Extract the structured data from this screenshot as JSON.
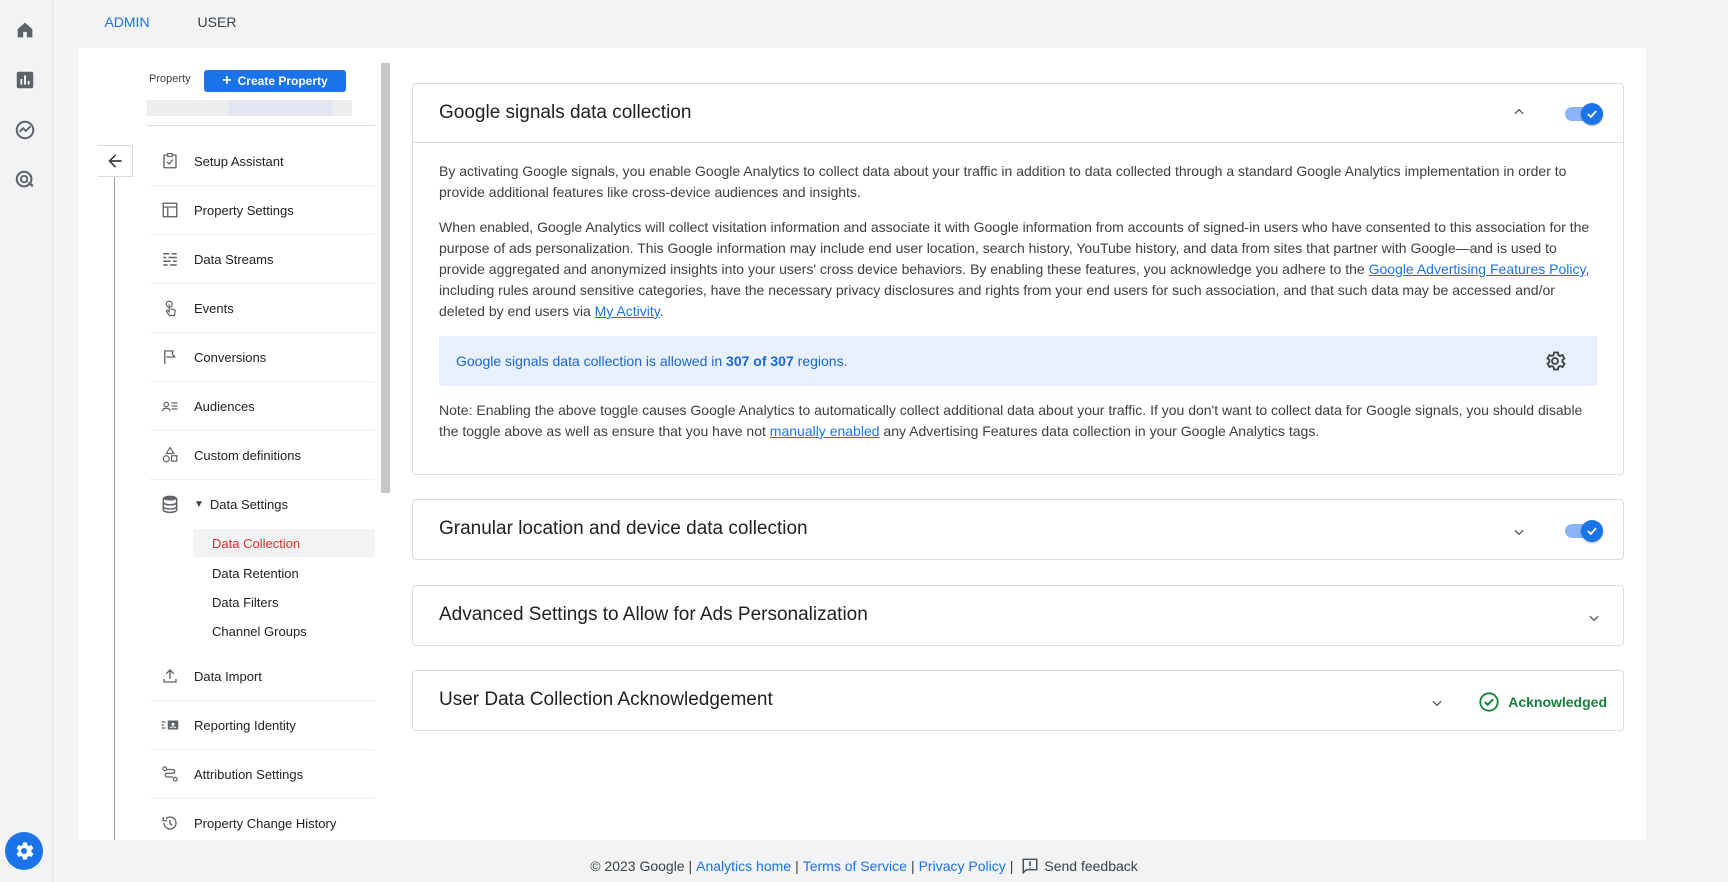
{
  "tabs": {
    "admin": "ADMIN",
    "user": "USER"
  },
  "rail": {
    "icons": [
      "home-icon",
      "reports-icon",
      "explore-icon",
      "advertising-icon"
    ],
    "settings_icon": "gear-icon"
  },
  "property": {
    "label": "Property",
    "create_button": "Create Property"
  },
  "nav": {
    "items": [
      {
        "label": "Setup Assistant",
        "icon": "checklist-icon"
      },
      {
        "label": "Property Settings",
        "icon": "window-icon"
      },
      {
        "label": "Data Streams",
        "icon": "streams-icon"
      },
      {
        "label": "Events",
        "icon": "touch-icon"
      },
      {
        "label": "Conversions",
        "icon": "flag-icon"
      },
      {
        "label": "Audiences",
        "icon": "audiences-icon"
      },
      {
        "label": "Custom definitions",
        "icon": "shapes-icon"
      },
      {
        "label": "Data Settings",
        "icon": "database-icon"
      }
    ],
    "sub_items": [
      "Data Collection",
      "Data Retention",
      "Data Filters",
      "Channel Groups"
    ],
    "items_after": [
      {
        "label": "Data Import",
        "icon": "upload-icon"
      },
      {
        "label": "Reporting Identity",
        "icon": "identity-icon"
      },
      {
        "label": "Attribution Settings",
        "icon": "attribution-icon"
      },
      {
        "label": "Property Change History",
        "icon": "history-icon"
      }
    ]
  },
  "cards": {
    "signals": {
      "title": "Google signals data collection",
      "p1": "By activating Google signals, you enable Google Analytics to collect data about your traffic in addition to data collected through a standard Google Analytics implementation in order to provide additional features like cross-device audiences and insights.",
      "p2_a": "When enabled, Google Analytics will collect visitation information and associate it with Google information from accounts of signed-in users who have consented to this association for the purpose of ads personalization. This Google information may include end user location, search history, YouTube history, and data from sites that partner with Google—and is used to provide aggregated and anonymized insights into your users' cross device behaviors. By enabling these features, you acknowledge you adhere to the ",
      "p2_link1": "Google Advertising Features Policy",
      "p2_b": ", including rules around sensitive categories, have the necessary privacy disclosures and rights from your end users for such association, and that such data may be accessed and/or deleted by end users via ",
      "p2_link2": "My Activity",
      "p2_c": ".",
      "info_a": "Google signals data collection is allowed in ",
      "info_bold": "307 of 307",
      "info_b": " regions.",
      "note_a": "Note: Enabling the above toggle causes Google Analytics to automatically collect additional data about your traffic. If you don't want to collect data for Google signals, you should disable the toggle above as well as ensure that you have not ",
      "note_link": "manually enabled",
      "note_b": " any Advertising Features data collection in your Google Analytics tags."
    },
    "granular": {
      "title": "Granular location and device data collection"
    },
    "advanced": {
      "title": "Advanced Settings to Allow for Ads Personalization"
    },
    "ack": {
      "title": "User Data Collection Acknowledgement",
      "status": "Acknowledged"
    }
  },
  "footer": {
    "copyright": "© 2023 Google |",
    "analytics_home": "Analytics home",
    "terms": "Terms of Service",
    "privacy": "Privacy Policy",
    "sep": "|",
    "feedback": "Send feedback"
  },
  "colors": {
    "accent": "#1a73e8",
    "active_nav": "#d93025",
    "success": "#188038",
    "tab_underline": "#e37400"
  }
}
